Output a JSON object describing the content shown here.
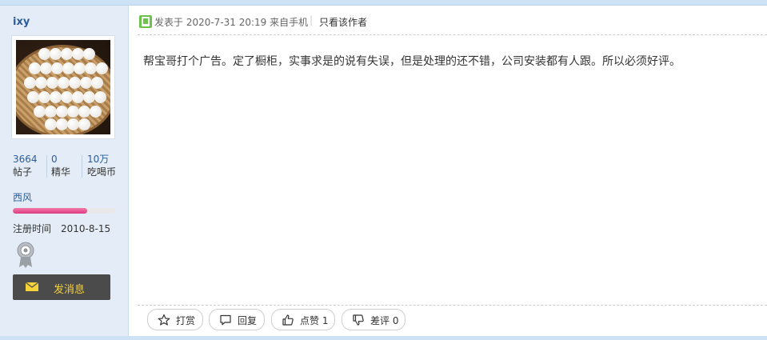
{
  "user": {
    "name": "ixy",
    "stats": [
      {
        "value": "3664",
        "label": "帖子"
      },
      {
        "value": "0",
        "label": "精华"
      },
      {
        "value": "10万",
        "label": "吃喝币"
      }
    ],
    "group": "西风",
    "level_progress": 0.72,
    "register_label": "注册时间",
    "register_date": "2010-8-15",
    "message_button": "发消息"
  },
  "post": {
    "meta": "发表于 2020-7-31 20:19 来自手机",
    "separator": "|",
    "only_author": "只看该作者",
    "content": "帮宝哥打个广告。定了橱柜，实事求是的说有失误，但是处理的还不错，公司安装都有人跟。所以必须好评。"
  },
  "actions": {
    "reward": "打赏",
    "reply": "回复",
    "like": "点赞 1",
    "dislike": "差评 0"
  },
  "colors": {
    "sidebar_bg": "#e4edf7",
    "link": "#2a5d9a",
    "progress": "#de3a82",
    "message_button_bg": "#4b4b4b",
    "message_button_text": "#f5d13a"
  }
}
